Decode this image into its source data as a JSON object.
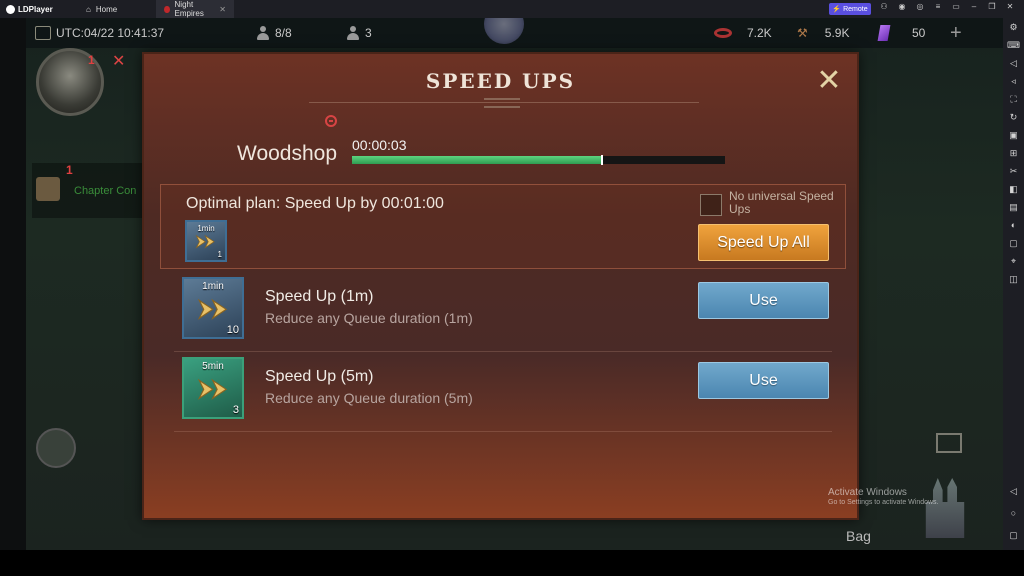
{
  "app": {
    "name": "LDPlayer",
    "tabs": [
      {
        "label": "Home"
      },
      {
        "label": "Night Empires"
      }
    ],
    "remote_label": "Remote"
  },
  "hud": {
    "utc": "UTC:04/22 10:41:37",
    "troops": "8/8",
    "players": "3",
    "resource_1": "7.2K",
    "resource_2": "5.9K",
    "gems": "50"
  },
  "left_panel": {
    "avatar_badge": "1",
    "chapter_badge": "1",
    "chapter_text": "Chapter Con"
  },
  "bottom": {
    "bag_label": "Bag",
    "watermark_title": "Activate Windows",
    "watermark_sub": "Go to Settings to activate Windows."
  },
  "dialog": {
    "title": "SPEED UPS",
    "building": "Woodshop",
    "timer": "00:00:03",
    "progress": 0.67,
    "optimal_text": "Optimal plan: Speed Up by 00:01:00",
    "optimal_item": {
      "label": "1min",
      "qty": "1"
    },
    "no_universal_label": "No universal Speed Ups",
    "speed_up_all": "Speed Up All",
    "items": [
      {
        "icon_label": "1min",
        "qty": "10",
        "title": "Speed Up (1m)",
        "desc": "Reduce any Queue duration (1m)",
        "button": "Use",
        "color": "#3f6e94"
      },
      {
        "icon_label": "5min",
        "qty": "3",
        "title": "Speed Up (5m)",
        "desc": "Reduce any Queue duration (5m)",
        "button": "Use",
        "color": "#3ba07a"
      }
    ]
  }
}
